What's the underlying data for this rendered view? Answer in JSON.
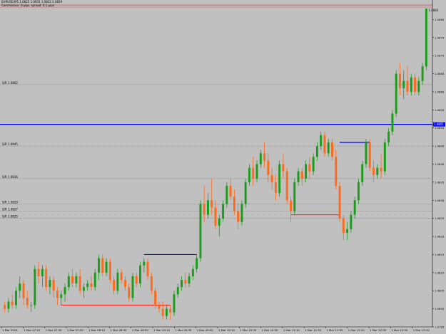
{
  "window": {
    "title": "EURUSD,M5   1.0825  1.0831  1.0823  1.0829",
    "subtitle": "Commission: 0 pips, spread: 0.1 pips"
  },
  "colors": {
    "background": "#c0c0c0",
    "bull": "#1a9b1a",
    "bear": "#ff6a1a",
    "ask_line": "#e03030",
    "blue_line": "#0000ff",
    "red_segment": "#ff3030",
    "level_line": "#7a7a7a",
    "axis_text": "#000000"
  },
  "chart_data": {
    "type": "candlestick",
    "ylim": [
      1.0795,
      1.0885
    ],
    "y_ticks": [
      {
        "label": "1.0880",
        "value": 1.088
      },
      {
        "label": "1.0875",
        "value": 1.0875
      },
      {
        "label": "1.0870",
        "value": 1.087
      },
      {
        "label": "1.0865",
        "value": 1.0865
      },
      {
        "label": "1.0860",
        "value": 1.086
      },
      {
        "label": "1.0855",
        "value": 1.0855
      },
      {
        "label": "1.0850",
        "value": 1.085
      },
      {
        "label": "1.0845",
        "value": 1.0845
      },
      {
        "label": "1.0840",
        "value": 1.084
      },
      {
        "label": "1.0835",
        "value": 1.0835
      },
      {
        "label": "1.0830",
        "value": 1.083
      },
      {
        "label": "1.0825",
        "value": 1.0825
      },
      {
        "label": "1.0820",
        "value": 1.082
      },
      {
        "label": "1.0815",
        "value": 1.0815
      },
      {
        "label": "1.0810",
        "value": 1.081
      },
      {
        "label": "1.0805",
        "value": 1.0805
      },
      {
        "label": "1.0800",
        "value": 1.08
      },
      {
        "label": "1.0795",
        "value": 1.0795
      }
    ],
    "x_ticks": [
      "1 Mar 2024",
      "1 Mar 07:10",
      "1 Mar 07:30",
      "1 Mar 07:50",
      "1 Mar 08:10",
      "1 Mar 08:30",
      "1 Mar 08:50",
      "1 Mar 09:10",
      "1 Mar 09:30",
      "1 Mar 09:50",
      "1 Mar 10:10",
      "1 Mar 10:30",
      "1 Mar 10:50",
      "1 Mar 11:10",
      "1 Mar 11:30",
      "1 Mar 11:50",
      "1 Mar 12:10",
      "1 Mar 12:30",
      "1 Mar 12:50",
      "1 Mar 13:10"
    ],
    "current_price": "1.0883",
    "ask_level": 1.0884,
    "blue_level": {
      "value": 1.0851,
      "label": "1.0851"
    },
    "horizontal_levels": [
      {
        "value": 1.0862,
        "label": "S/R 1.0862"
      },
      {
        "value": 1.0845,
        "label": "S/R 1.0845"
      },
      {
        "value": 1.0836,
        "label": "S/R 1.0836"
      },
      {
        "value": 1.0829,
        "label": "S/R 1.0829"
      },
      {
        "value": 1.0827,
        "label": "S/R 1.0827"
      },
      {
        "value": 1.0825,
        "label": "S/R 1.0825"
      }
    ],
    "segments": [
      {
        "color": "blue",
        "i0": 37,
        "i1": 51,
        "y": 1.0815
      },
      {
        "color": "red",
        "i0": 15,
        "i1": 44,
        "y": 1.0801
      },
      {
        "color": "blue",
        "i0": 89,
        "i1": 97,
        "y": 1.0846
      },
      {
        "color": "red",
        "i0": 76,
        "i1": 89,
        "y": 1.0826
      }
    ],
    "candles": [
      [
        1.0801,
        1.0802,
        1.0799,
        1.08
      ],
      [
        1.08,
        1.0803,
        1.0799,
        1.0802
      ],
      [
        1.0802,
        1.0804,
        1.08,
        1.0801
      ],
      [
        1.0801,
        1.0806,
        1.08,
        1.0805
      ],
      [
        1.0805,
        1.0809,
        1.0803,
        1.0807
      ],
      [
        1.0807,
        1.0808,
        1.0801,
        1.0803
      ],
      [
        1.0803,
        1.0805,
        1.08,
        1.0801
      ],
      [
        1.0801,
        1.0802,
        1.0799,
        1.0801
      ],
      [
        1.0801,
        1.0812,
        1.08,
        1.0811
      ],
      [
        1.0811,
        1.0813,
        1.0807,
        1.0809
      ],
      [
        1.0809,
        1.0812,
        1.0806,
        1.0811
      ],
      [
        1.0811,
        1.0812,
        1.0805,
        1.0806
      ],
      [
        1.0806,
        1.0809,
        1.0804,
        1.0808
      ],
      [
        1.0808,
        1.0809,
        1.0803,
        1.0805
      ],
      [
        1.0805,
        1.0806,
        1.0801,
        1.0803
      ],
      [
        1.0803,
        1.0805,
        1.0801,
        1.0804
      ],
      [
        1.0804,
        1.0807,
        1.0802,
        1.0806
      ],
      [
        1.0806,
        1.081,
        1.0805,
        1.0809
      ],
      [
        1.0809,
        1.0811,
        1.0806,
        1.0807
      ],
      [
        1.0807,
        1.081,
        1.0806,
        1.0809
      ],
      [
        1.0809,
        1.0811,
        1.0804,
        1.0805
      ],
      [
        1.0805,
        1.0807,
        1.0803,
        1.0806
      ],
      [
        1.0806,
        1.0808,
        1.0805,
        1.0807
      ],
      [
        1.0807,
        1.0809,
        1.0805,
        1.0806
      ],
      [
        1.0806,
        1.0811,
        1.0805,
        1.081
      ],
      [
        1.081,
        1.0815,
        1.0808,
        1.0814
      ],
      [
        1.0814,
        1.0815,
        1.0809,
        1.081
      ],
      [
        1.081,
        1.0814,
        1.0809,
        1.0813
      ],
      [
        1.0813,
        1.0814,
        1.0807,
        1.0808
      ],
      [
        1.0808,
        1.0809,
        1.0804,
        1.0805
      ],
      [
        1.0805,
        1.0811,
        1.0804,
        1.081
      ],
      [
        1.081,
        1.0811,
        1.0807,
        1.0808
      ],
      [
        1.0808,
        1.0809,
        1.0805,
        1.0806
      ],
      [
        1.0806,
        1.0807,
        1.0802,
        1.0803
      ],
      [
        1.0803,
        1.081,
        1.0802,
        1.0809
      ],
      [
        1.0809,
        1.081,
        1.0806,
        1.0807
      ],
      [
        1.0807,
        1.0813,
        1.0806,
        1.0812
      ],
      [
        1.0812,
        1.0814,
        1.081,
        1.0813
      ],
      [
        1.0813,
        1.0814,
        1.0808,
        1.0809
      ],
      [
        1.0809,
        1.081,
        1.0804,
        1.0805
      ],
      [
        1.0805,
        1.0806,
        1.08,
        1.0801
      ],
      [
        1.0801,
        1.0802,
        1.0799,
        1.08
      ],
      [
        1.08,
        1.0802,
        1.0797,
        1.0798
      ],
      [
        1.0798,
        1.0801,
        1.0797,
        1.08
      ],
      [
        1.08,
        1.0801,
        1.0797,
        1.0799
      ],
      [
        1.0799,
        1.0805,
        1.0798,
        1.0804
      ],
      [
        1.0804,
        1.0807,
        1.0803,
        1.0806
      ],
      [
        1.0806,
        1.0809,
        1.0805,
        1.0808
      ],
      [
        1.0808,
        1.081,
        1.0806,
        1.0807
      ],
      [
        1.0807,
        1.081,
        1.0806,
        1.0809
      ],
      [
        1.0809,
        1.0812,
        1.0808,
        1.0811
      ],
      [
        1.0811,
        1.0815,
        1.081,
        1.0814
      ],
      [
        1.0814,
        1.083,
        1.0813,
        1.0829
      ],
      [
        1.0829,
        1.0834,
        1.0824,
        1.0826
      ],
      [
        1.0826,
        1.0832,
        1.0825,
        1.083
      ],
      [
        1.083,
        1.0836,
        1.0826,
        1.0828
      ],
      [
        1.0828,
        1.083,
        1.0822,
        1.0823
      ],
      [
        1.0823,
        1.0826,
        1.082,
        1.0825
      ],
      [
        1.0825,
        1.083,
        1.0824,
        1.0829
      ],
      [
        1.0829,
        1.0835,
        1.0828,
        1.0834
      ],
      [
        1.0834,
        1.0836,
        1.083,
        1.0831
      ],
      [
        1.0831,
        1.0833,
        1.0826,
        1.0827
      ],
      [
        1.0827,
        1.0829,
        1.0822,
        1.0824
      ],
      [
        1.0824,
        1.083,
        1.0823,
        1.0829
      ],
      [
        1.0829,
        1.0836,
        1.0828,
        1.0835
      ],
      [
        1.0835,
        1.084,
        1.0834,
        1.0839
      ],
      [
        1.0839,
        1.0842,
        1.0834,
        1.0836
      ],
      [
        1.0836,
        1.0841,
        1.0835,
        1.084
      ],
      [
        1.084,
        1.0844,
        1.0839,
        1.0843
      ],
      [
        1.0843,
        1.0846,
        1.0839,
        1.0841
      ],
      [
        1.0841,
        1.0843,
        1.0835,
        1.0837
      ],
      [
        1.0837,
        1.0839,
        1.0833,
        1.0835
      ],
      [
        1.0835,
        1.0837,
        1.083,
        1.0832
      ],
      [
        1.0832,
        1.0841,
        1.0831,
        1.084
      ],
      [
        1.084,
        1.0843,
        1.0836,
        1.0838
      ],
      [
        1.0838,
        1.0839,
        1.0829,
        1.083
      ],
      [
        1.083,
        1.0831,
        1.0824,
        1.0827
      ],
      [
        1.0827,
        1.0836,
        1.0826,
        1.0835
      ],
      [
        1.0835,
        1.0839,
        1.0834,
        1.0838
      ],
      [
        1.0838,
        1.0839,
        1.0834,
        1.0836
      ],
      [
        1.0836,
        1.0841,
        1.0835,
        1.084
      ],
      [
        1.084,
        1.0842,
        1.0836,
        1.0838
      ],
      [
        1.0838,
        1.0843,
        1.0837,
        1.0842
      ],
      [
        1.0842,
        1.0846,
        1.0841,
        1.0845
      ],
      [
        1.0845,
        1.0849,
        1.0844,
        1.0848
      ],
      [
        1.0848,
        1.0849,
        1.0842,
        1.0843
      ],
      [
        1.0843,
        1.0847,
        1.0842,
        1.0846
      ],
      [
        1.0846,
        1.0847,
        1.0841,
        1.0842
      ],
      [
        1.0842,
        1.0844,
        1.0833,
        1.0834
      ],
      [
        1.0834,
        1.0835,
        1.0824,
        1.0825
      ],
      [
        1.0825,
        1.0826,
        1.0819,
        1.0821
      ],
      [
        1.0821,
        1.0824,
        1.0819,
        1.0822
      ],
      [
        1.0822,
        1.0827,
        1.0821,
        1.0826
      ],
      [
        1.0826,
        1.0831,
        1.0825,
        1.083
      ],
      [
        1.083,
        1.0836,
        1.0829,
        1.0835
      ],
      [
        1.0835,
        1.0841,
        1.0834,
        1.084
      ],
      [
        1.084,
        1.0847,
        1.0839,
        1.0846
      ],
      [
        1.0846,
        1.0847,
        1.0838,
        1.0839
      ],
      [
        1.0839,
        1.0841,
        1.0835,
        1.0837
      ],
      [
        1.0837,
        1.084,
        1.0836,
        1.0839
      ],
      [
        1.0839,
        1.0843,
        1.0836,
        1.0838
      ],
      [
        1.0838,
        1.0847,
        1.0837,
        1.0846
      ],
      [
        1.0846,
        1.085,
        1.0845,
        1.0849
      ],
      [
        1.0849,
        1.0855,
        1.0848,
        1.0854
      ],
      [
        1.0854,
        1.0866,
        1.0853,
        1.0865
      ],
      [
        1.0865,
        1.0868,
        1.0859,
        1.0861
      ],
      [
        1.0861,
        1.0866,
        1.0858,
        1.0863
      ],
      [
        1.0863,
        1.0867,
        1.0859,
        1.086
      ],
      [
        1.086,
        1.0865,
        1.0859,
        1.0864
      ],
      [
        1.0864,
        1.0865,
        1.0859,
        1.086
      ],
      [
        1.086,
        1.0864,
        1.0859,
        1.0863
      ],
      [
        1.0863,
        1.0868,
        1.0862,
        1.0867
      ],
      [
        1.0867,
        1.0883,
        1.0866,
        1.0883
      ]
    ]
  }
}
